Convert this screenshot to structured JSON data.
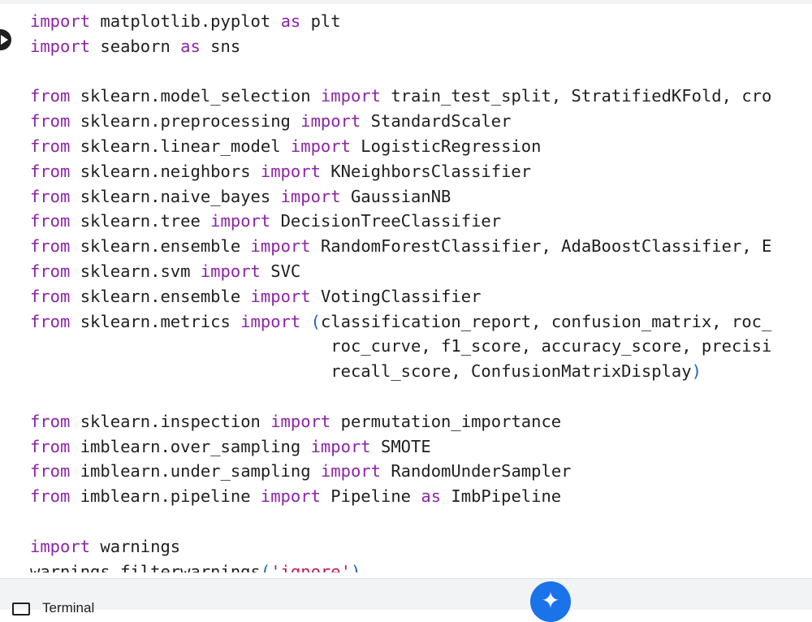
{
  "code": {
    "lines": [
      [
        {
          "t": "import",
          "c": "kw"
        },
        {
          "t": " matplotlib.pyplot ",
          "c": ""
        },
        {
          "t": "as",
          "c": "kw"
        },
        {
          "t": " plt",
          "c": ""
        }
      ],
      [
        {
          "t": "import",
          "c": "kw"
        },
        {
          "t": " seaborn ",
          "c": ""
        },
        {
          "t": "as",
          "c": "kw"
        },
        {
          "t": " sns",
          "c": ""
        }
      ],
      [],
      [
        {
          "t": "from",
          "c": "kw"
        },
        {
          "t": " sklearn.model_selection ",
          "c": ""
        },
        {
          "t": "import",
          "c": "kw"
        },
        {
          "t": " train_test_split, StratifiedKFold, cro",
          "c": ""
        }
      ],
      [
        {
          "t": "from",
          "c": "kw"
        },
        {
          "t": " sklearn.preprocessing ",
          "c": ""
        },
        {
          "t": "import",
          "c": "kw"
        },
        {
          "t": " StandardScaler",
          "c": ""
        }
      ],
      [
        {
          "t": "from",
          "c": "kw"
        },
        {
          "t": " sklearn.linear_model ",
          "c": ""
        },
        {
          "t": "import",
          "c": "kw"
        },
        {
          "t": " LogisticRegression",
          "c": ""
        }
      ],
      [
        {
          "t": "from",
          "c": "kw"
        },
        {
          "t": " sklearn.neighbors ",
          "c": ""
        },
        {
          "t": "import",
          "c": "kw"
        },
        {
          "t": " KNeighborsClassifier",
          "c": ""
        }
      ],
      [
        {
          "t": "from",
          "c": "kw"
        },
        {
          "t": " sklearn.naive_bayes ",
          "c": ""
        },
        {
          "t": "import",
          "c": "kw"
        },
        {
          "t": " GaussianNB",
          "c": ""
        }
      ],
      [
        {
          "t": "from",
          "c": "kw"
        },
        {
          "t": " sklearn.tree ",
          "c": ""
        },
        {
          "t": "import",
          "c": "kw"
        },
        {
          "t": " DecisionTreeClassifier",
          "c": ""
        }
      ],
      [
        {
          "t": "from",
          "c": "kw"
        },
        {
          "t": " sklearn.ensemble ",
          "c": ""
        },
        {
          "t": "import",
          "c": "kw"
        },
        {
          "t": " RandomForestClassifier, AdaBoostClassifier, E",
          "c": ""
        }
      ],
      [
        {
          "t": "from",
          "c": "kw"
        },
        {
          "t": " sklearn.svm ",
          "c": ""
        },
        {
          "t": "import",
          "c": "kw"
        },
        {
          "t": " SVC",
          "c": ""
        }
      ],
      [
        {
          "t": "from",
          "c": "kw"
        },
        {
          "t": " sklearn.ensemble ",
          "c": ""
        },
        {
          "t": "import",
          "c": "kw"
        },
        {
          "t": " VotingClassifier",
          "c": ""
        }
      ],
      [
        {
          "t": "from",
          "c": "kw"
        },
        {
          "t": " sklearn.metrics ",
          "c": ""
        },
        {
          "t": "import",
          "c": "kw"
        },
        {
          "t": " ",
          "c": ""
        },
        {
          "t": "(",
          "c": "pn"
        },
        {
          "t": "classification_report, confusion_matrix, roc_",
          "c": ""
        }
      ],
      [
        {
          "t": "                              roc_curve, f1_score, accuracy_score, precisi",
          "c": ""
        }
      ],
      [
        {
          "t": "                              recall_score, ConfusionMatrixDisplay",
          "c": ""
        },
        {
          "t": ")",
          "c": "pn"
        }
      ],
      [],
      [
        {
          "t": "from",
          "c": "kw"
        },
        {
          "t": " sklearn.inspection ",
          "c": ""
        },
        {
          "t": "import",
          "c": "kw"
        },
        {
          "t": " permutation_importance",
          "c": ""
        }
      ],
      [
        {
          "t": "from",
          "c": "kw"
        },
        {
          "t": " imblearn.over_sampling ",
          "c": ""
        },
        {
          "t": "import",
          "c": "kw"
        },
        {
          "t": " SMOTE",
          "c": ""
        }
      ],
      [
        {
          "t": "from",
          "c": "kw"
        },
        {
          "t": " imblearn.under_sampling ",
          "c": ""
        },
        {
          "t": "import",
          "c": "kw"
        },
        {
          "t": " RandomUnderSampler",
          "c": ""
        }
      ],
      [
        {
          "t": "from",
          "c": "kw"
        },
        {
          "t": " imblearn.pipeline ",
          "c": ""
        },
        {
          "t": "import",
          "c": "kw"
        },
        {
          "t": " Pipeline ",
          "c": ""
        },
        {
          "t": "as",
          "c": "kw"
        },
        {
          "t": " ImbPipeline",
          "c": ""
        }
      ],
      [],
      [
        {
          "t": "import",
          "c": "kw"
        },
        {
          "t": " warnings",
          "c": ""
        }
      ],
      [
        {
          "t": "warnings.filterwarnings",
          "c": ""
        },
        {
          "t": "(",
          "c": "pn"
        },
        {
          "t": "'ignore'",
          "c": "st"
        },
        {
          "t": ")",
          "c": "pn"
        }
      ]
    ]
  },
  "bottom_bar": {
    "terminal_label": "Terminal",
    "gemini_icon": "sparkle-icon"
  },
  "run_icon": "play-icon",
  "colors": {
    "keyword": "#8e24aa",
    "string": "#c2185b",
    "paren": "#1e63c5",
    "text": "#1f1f1f",
    "accent": "#1a73e8"
  }
}
